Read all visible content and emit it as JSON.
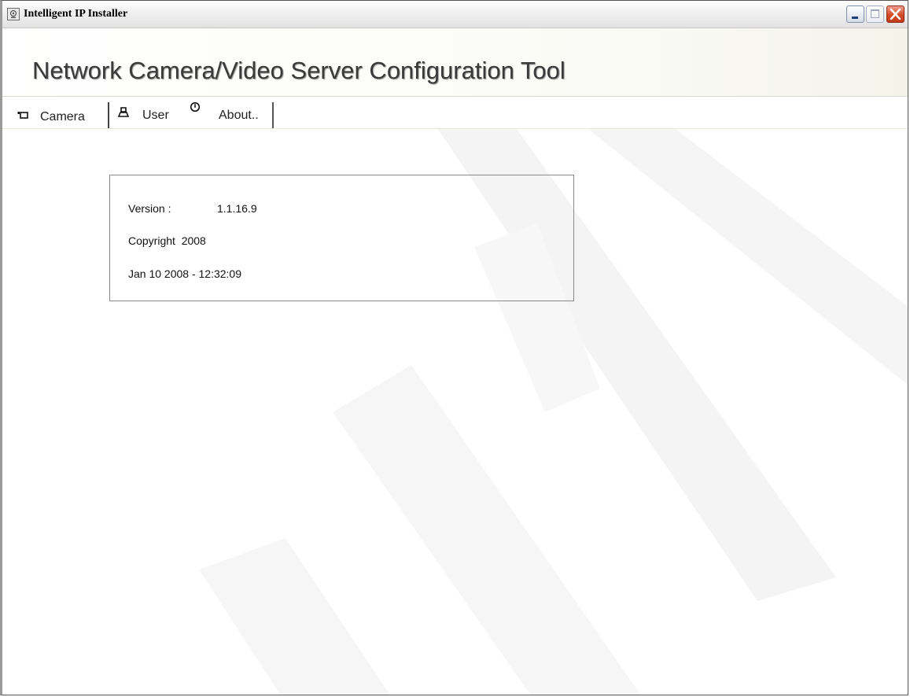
{
  "window": {
    "title": "Intelligent IP Installer",
    "icon": "app-camera-icon",
    "controls": [
      "minimize-icon",
      "maximize-icon",
      "close-icon"
    ]
  },
  "banner": {
    "title": "Network Camera/Video Server Configuration Tool"
  },
  "tabs": [
    {
      "label": "Camera",
      "icon": "camera-icon",
      "active": false
    },
    {
      "label": "User",
      "icon": "user-icon",
      "active": false
    },
    {
      "label": "About..",
      "icon": "info-icon",
      "active": true
    }
  ],
  "about": {
    "version_label": "Version :",
    "version_value": "1.1.16.9",
    "copyright": "Copyright  2008",
    "build_date": "Jan 10 2008 - 12:32:09"
  },
  "colors": {
    "close_button": "#d44b2a",
    "banner_text": "#3a3a3a",
    "box_border": "#8a8a8a"
  }
}
